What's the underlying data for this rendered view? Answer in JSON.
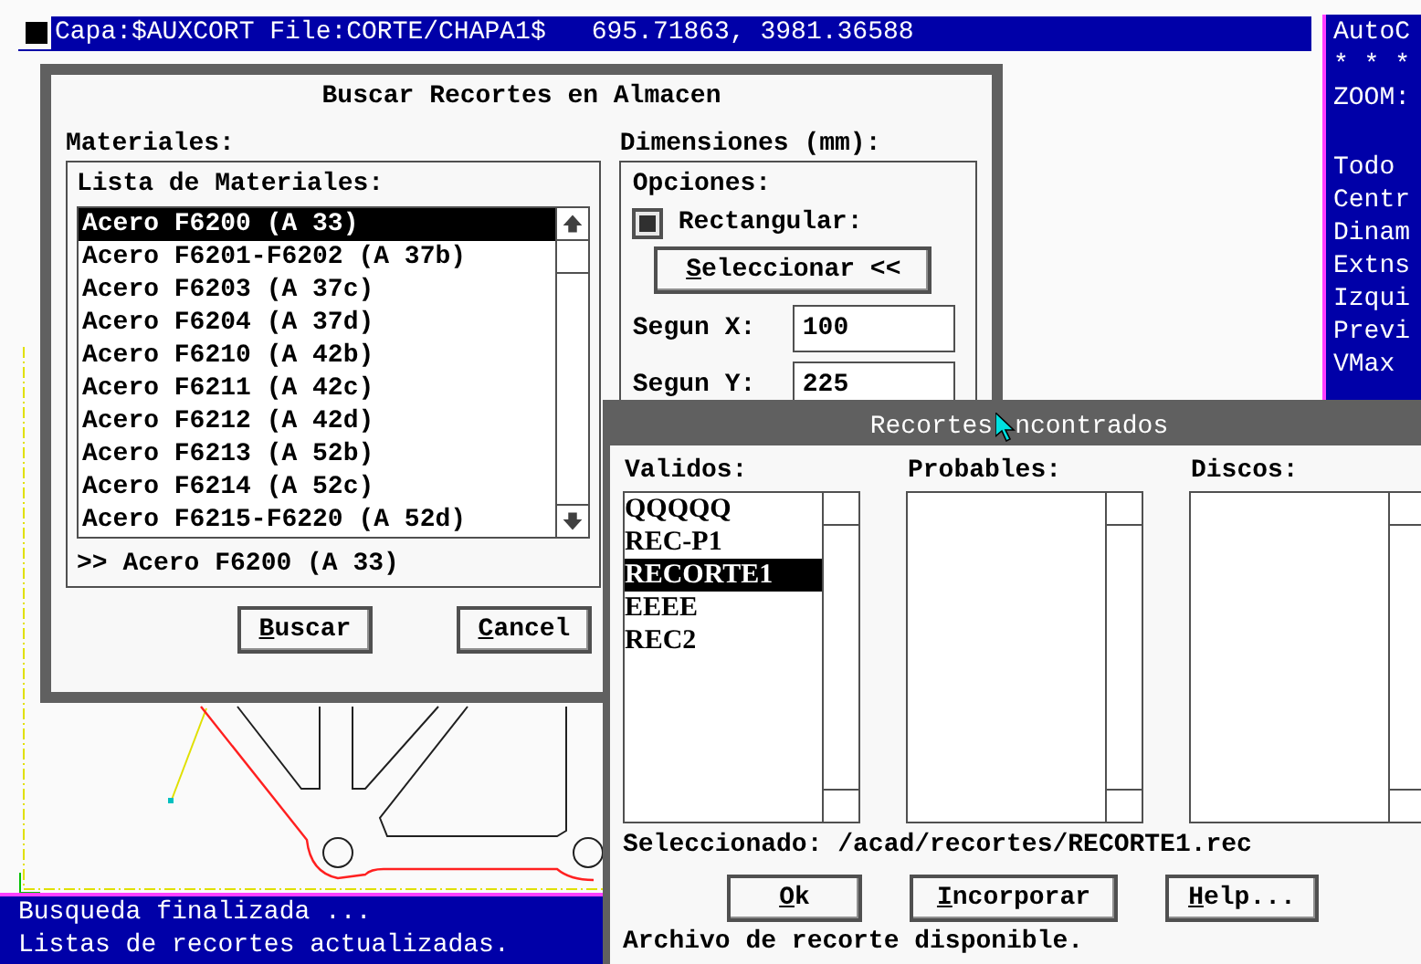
{
  "top_bar": {
    "layer_file": "Capa:$AUXCORT File:CORTE/CHAPA1$",
    "coordinates": "695.71863, 3981.36588"
  },
  "side_menu": {
    "header": [
      "AutoC",
      "* * *",
      "ZOOM:"
    ],
    "items": [
      "Todo",
      "Centr",
      "Dinam",
      "Extns",
      "Izqui",
      "Previ",
      "VMax"
    ]
  },
  "command_lines": [
    "Busqueda finalizada ...",
    "Listas de recortes actualizadas."
  ],
  "search_dialog": {
    "title": "Buscar Recortes en Almacen",
    "materials_label": "Materiales:",
    "list_label": "Lista de Materiales:",
    "materials": [
      {
        "label": "Acero F6200 (A 33)",
        "selected": true
      },
      {
        "label": "Acero F6201-F6202 (A 37b)",
        "selected": false
      },
      {
        "label": "Acero F6203 (A 37c)",
        "selected": false
      },
      {
        "label": "Acero F6204 (A 37d)",
        "selected": false
      },
      {
        "label": "Acero F6210 (A 42b)",
        "selected": false
      },
      {
        "label": "Acero F6211 (A 42c)",
        "selected": false
      },
      {
        "label": "Acero F6212 (A 42d)",
        "selected": false
      },
      {
        "label": "Acero F6213 (A 52b)",
        "selected": false
      },
      {
        "label": "Acero F6214 (A 52c)",
        "selected": false
      },
      {
        "label": "Acero F6215-F6220 (A 52d)",
        "selected": false
      }
    ],
    "selection": ">> Acero F6200 (A 33)",
    "dimensions_label": "Dimensiones (mm):",
    "options_label": "Opciones:",
    "rectangular": {
      "label": "Rectangular:",
      "checked": true
    },
    "select_button": "Seleccionar <<",
    "x_label": "Segun X:",
    "x_value": "100",
    "y_label": "Segun Y:",
    "y_value": "225",
    "buttons": [
      "Buscar",
      "Cancel"
    ]
  },
  "results_dialog": {
    "title_parts": [
      "Recortes",
      "ncontrados"
    ],
    "columns": [
      {
        "label": "Validos:",
        "items": [
          {
            "label": "QQQQQ",
            "selected": false
          },
          {
            "label": "REC-P1",
            "selected": false
          },
          {
            "label": "RECORTE1",
            "selected": true
          },
          {
            "label": "EEEE",
            "selected": false
          },
          {
            "label": "REC2",
            "selected": false
          }
        ]
      },
      {
        "label": "Probables:"
      },
      {
        "label": "Discos:"
      }
    ],
    "selected_path": "Seleccionado: /acad/recortes/RECORTE1.rec",
    "buttons": [
      "Ok",
      "Incorporar",
      "Help..."
    ],
    "message": "Archivo de recorte disponible."
  }
}
